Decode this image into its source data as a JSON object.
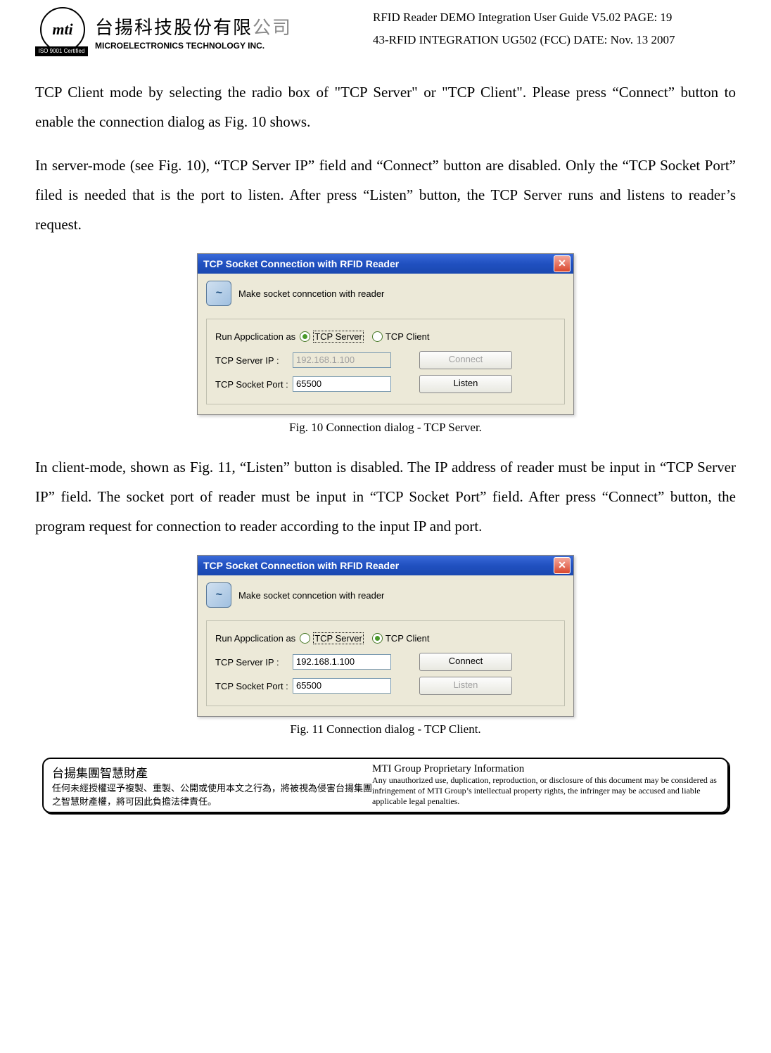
{
  "header": {
    "logo_text": "mti",
    "cert": "ISO 9001 Certified",
    "company_cn_black": "台揚科技股份有限",
    "company_cn_gray": "公司",
    "company_en": "MICROELECTRONICS TECHNOLOGY INC.",
    "right_line1": "RFID Reader DEMO Integration User Guide V5.02   PAGE: 19",
    "right_line2": "43-RFID  INTEGRATION  UG502  (FCC)     DATE:  Nov.  13  2007"
  },
  "para1": "TCP Client mode by selecting the radio box of \"TCP Server\" or \"TCP Client\".  Please press “Connect” button to enable the connection dialog as Fig. 10 shows.",
  "para2": "In server-mode (see Fig. 10), “TCP Server IP” field and “Connect” button are disabled.  Only the “TCP Socket Port” filed is needed that is the port to listen.  After press “Listen” button, the TCP Server runs and listens to reader’s request.",
  "dialog1": {
    "title": "TCP Socket Connection with RFID Reader",
    "msg": "Make socket conncetion with reader",
    "run_as": "Run Appclication as",
    "opt_server": "TCP Server",
    "opt_client": "TCP Client",
    "ip_label": "TCP Server IP :",
    "ip_value": "192.168.1.100",
    "port_label": "TCP Socket Port :",
    "port_value": "65500",
    "connect": "Connect",
    "listen": "Listen"
  },
  "caption1": "Fig. 10    Connection dialog - TCP Server.",
  "para3": "In client-mode, shown as Fig. 11, “Listen” button is disabled.    The IP address of reader must be input in “TCP Server IP” field.    The socket port of reader must be input in “TCP Socket Port” field.    After press “Connect” button, the program request for connection to reader according to the input IP and port.",
  "dialog2": {
    "title": "TCP Socket Connection with RFID Reader",
    "msg": "Make socket conncetion with reader",
    "run_as": "Run Appclication as",
    "opt_server": "TCP Server",
    "opt_client": "TCP Client",
    "ip_label": "TCP Server IP :",
    "ip_value": "192.168.1.100",
    "port_label": "TCP Socket Port :",
    "port_value": "65500",
    "connect": "Connect",
    "listen": "Listen"
  },
  "caption2": "Fig. 11    Connection dialog - TCP Client.",
  "footer": {
    "left_title": "台揚集團智慧財產",
    "left_body": "任何未經授權逕予複製、重製、公開或使用本文之行為，將被視為侵害台揚集團之智慧財產權，將可因此負擔法律責任。",
    "right_title": "MTI Group Proprietary Information",
    "right_body": "Any unauthorized use, duplication, reproduction, or disclosure of this document may be considered as infringement of MTI Group’s intellectual property rights, the infringer may be accused and liable applicable legal penalties."
  }
}
